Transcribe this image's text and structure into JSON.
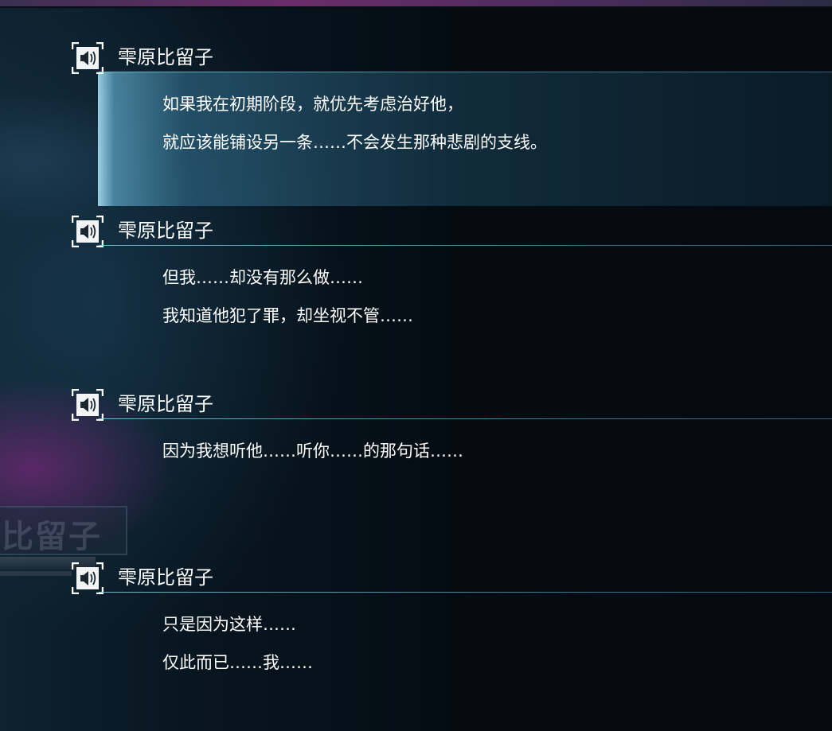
{
  "backlog": {
    "entries": [
      {
        "speaker": "雫原比留子",
        "lines": [
          "如果我在初期阶段，就优先考虑治好他，",
          "就应该能铺设另一条……不会发生那种悲剧的支线。"
        ],
        "highlighted": true
      },
      {
        "speaker": "雫原比留子",
        "lines": [
          "但我……却没有那么做……",
          "我知道他犯了罪，却坐视不管……"
        ],
        "highlighted": false
      },
      {
        "speaker": "雫原比留子",
        "lines": [
          "因为我想听他……听你……的那句话……"
        ],
        "highlighted": false
      },
      {
        "speaker": "雫原比留子",
        "lines": [
          "只是因为这样……",
          "仅此而已……我……"
        ],
        "highlighted": false
      }
    ]
  },
  "voice_icon": "speaker-volume-icon",
  "colors": {
    "highlight": "#5fa8c4",
    "divider": "#7ec8dc",
    "text": "#ffffff",
    "background": "#050d14",
    "accent_purple": "#962a8c"
  }
}
